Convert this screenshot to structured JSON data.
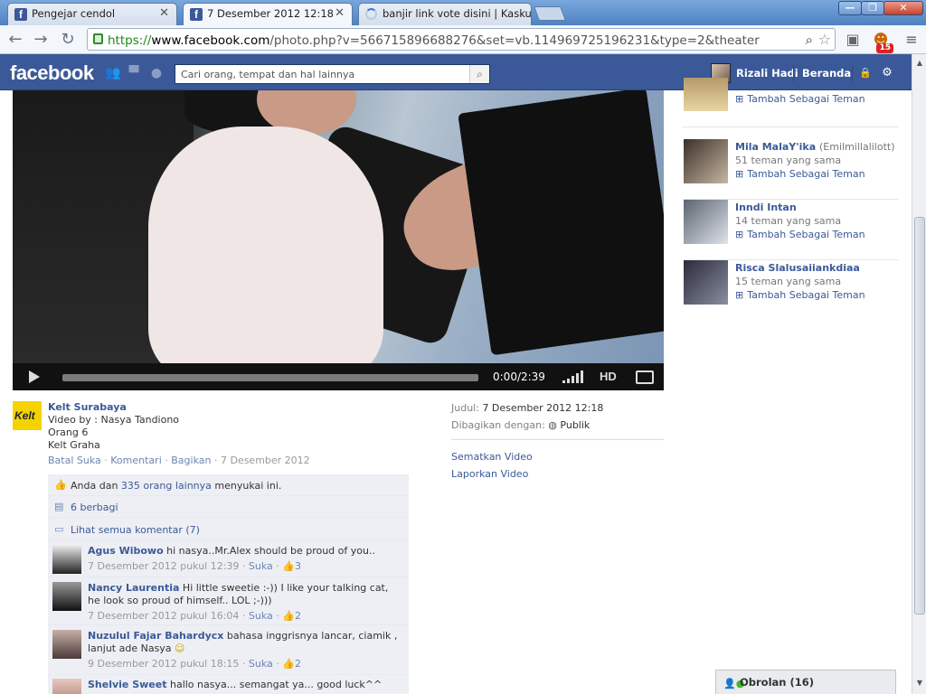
{
  "browser": {
    "tabs": [
      {
        "title": "Pengejar cendol",
        "icon": "facebook-icon",
        "active": false
      },
      {
        "title": "7 Desember 2012 12:18",
        "icon": "facebook-icon",
        "active": true
      },
      {
        "title": "banjir link vote disini | Kaskus",
        "icon": "loading-spinner-icon",
        "active": false
      }
    ],
    "url_scheme": "https://",
    "url_host": "www.facebook.com",
    "url_path": "/photo.php?v=566715896688276&set=vb.114969725196231&type=2&theater",
    "extension_badge": "15",
    "window_buttons": [
      "—",
      "❐",
      "✕"
    ]
  },
  "facebook": {
    "logo": "facebook",
    "search_placeholder": "Cari orang, tempat dan hal lainnya",
    "user_name": "Rizali Hadi",
    "home_label": "Beranda"
  },
  "video": {
    "time": "0:00/2:39",
    "hd_label": "HD"
  },
  "post": {
    "author": "Kelt Surabaya",
    "avatar_text": "Kelt",
    "lines": [
      "Video by : Nasya Tandiono",
      "Orang 6",
      "Kelt Graha"
    ],
    "actions": {
      "unlike": "Batal Suka",
      "comment": "Komentari",
      "share": "Bagikan",
      "date": "7 Desember 2012"
    },
    "likes": {
      "prefix": "Anda dan ",
      "link": "335 orang lainnya",
      "suffix": " menyukai ini."
    },
    "shares": "6 berbagi",
    "view_all_comments": "Lihat semua komentar (7)",
    "comments": [
      {
        "name": "Agus Wibowo",
        "text": "hi nasya..Mr.Alex should be proud of you..",
        "time": "7 Desember 2012 pukul 12:39",
        "like": "Suka",
        "likes": "3"
      },
      {
        "name": "Nancy Laurentia",
        "text": "Hi little sweetie :-)) I like your talking cat, he look so proud of himself.. LOL ;-)))",
        "time": "7 Desember 2012 pukul 16:04",
        "like": "Suka",
        "likes": "2"
      },
      {
        "name": "Nuzulul Fajar Bahardycx",
        "text": "bahasa inggrisnya lancar, ciamik , lanjut ade Nasya",
        "time": "9 Desember 2012 pukul 18:15",
        "like": "Suka",
        "likes": "2"
      },
      {
        "name": "Shelvie Sweet",
        "text": "hallo nasya... semangat ya... good luck^^",
        "time": "",
        "like": "",
        "likes": ""
      }
    ]
  },
  "info": {
    "title_label": "Judul:",
    "title_value": "7 Desember 2012 12:18",
    "shared_label": "Dibagikan dengan:",
    "shared_value": "Publik",
    "embed": "Sematkan Video",
    "report": "Laporkan Video"
  },
  "suggestions": {
    "add_label": "Tambah Sebagai Teman",
    "people": [
      {
        "name": "",
        "alt": "",
        "mutual": ""
      },
      {
        "name": "Mila MalaY'ika",
        "alt": "(Emilmillalilott)",
        "mutual": "51 teman yang sama"
      },
      {
        "name": "Inndi Intan",
        "alt": "",
        "mutual": "14 teman yang sama"
      },
      {
        "name": "Risca Slalusaiiankdiaa",
        "alt": "",
        "mutual": "15 teman yang sama"
      }
    ]
  },
  "chat": {
    "label": "Obrolan (16)"
  },
  "colors": {
    "fb_blue": "#3b5998",
    "link": "#3b5998",
    "ufi_bg": "#edeff4"
  }
}
